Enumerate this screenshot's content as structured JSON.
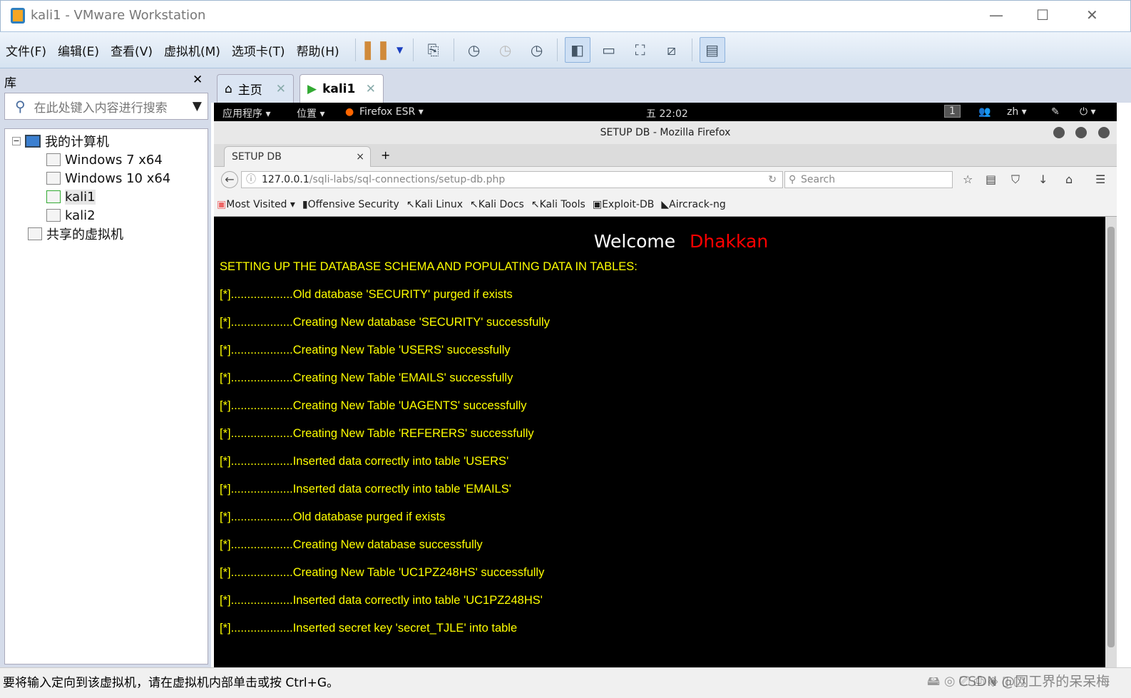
{
  "window": {
    "title": "kali1 - VMware Workstation"
  },
  "menu": [
    "文件(F)",
    "编辑(E)",
    "查看(V)",
    "虚拟机(M)",
    "选项卡(T)",
    "帮助(H)"
  ],
  "library": {
    "title": "库",
    "search_placeholder": "在此处键入内容进行搜索",
    "tree": {
      "root": "我的计算机",
      "vms": [
        "Windows 7 x64",
        "Windows 10 x64",
        "kali1",
        "kali2"
      ],
      "shared": "共享的虚拟机"
    }
  },
  "tabs": [
    {
      "label": "主页"
    },
    {
      "label": "kali1"
    }
  ],
  "gnome": {
    "apps": "应用程序 ▾",
    "places": "位置 ▾",
    "firefox": "Firefox ESR ▾",
    "clock": "五 22:02",
    "workspace": "1",
    "lang": "zh ▾"
  },
  "firefox": {
    "title": "SETUP DB - Mozilla Firefox",
    "tab": "SETUP DB",
    "url_host": "127.0.0.1",
    "url_path": "/sqli-labs/sql-connections/setup-db.php",
    "search_placeholder": "Search",
    "bookmarks": [
      "Most Visited ▾",
      "Offensive Security",
      "Kali Linux",
      "Kali Docs",
      "Kali Tools",
      "Exploit-DB",
      "Aircrack-ng"
    ]
  },
  "page": {
    "welcome": "Welcome",
    "name": "Dhakkan",
    "heading": "SETTING UP THE DATABASE SCHEMA AND POPULATING DATA IN TABLES:",
    "lines": [
      "[*]...................Old database 'SECURITY' purged if exists",
      "[*]...................Creating New database 'SECURITY' successfully",
      "[*]...................Creating New Table 'USERS' successfully",
      "[*]...................Creating New Table 'EMAILS' successfully",
      "[*]...................Creating New Table 'UAGENTS' successfully",
      "[*]...................Creating New Table 'REFERERS' successfully",
      "[*]...................Inserted data correctly into table 'USERS'",
      "[*]...................Inserted data correctly into table 'EMAILS'",
      "[*]...................Old database purged if exists",
      "[*]...................Creating New database successfully",
      "[*]...................Creating New Table 'UC1PZ248HS' successfully",
      "[*]...................Inserted data correctly into table 'UC1PZ248HS'",
      "[*]...................Inserted secret key 'secret_TJLE' into table"
    ]
  },
  "status": {
    "text": "要将输入定向到该虚拟机，请在虚拟机内部单击或按 Ctrl+G。",
    "watermark": "CSDN @网工界的呆呆梅"
  },
  "colors": {
    "text_yellow": "#ffff00",
    "name_red": "#ff0000",
    "background": "#000000"
  }
}
